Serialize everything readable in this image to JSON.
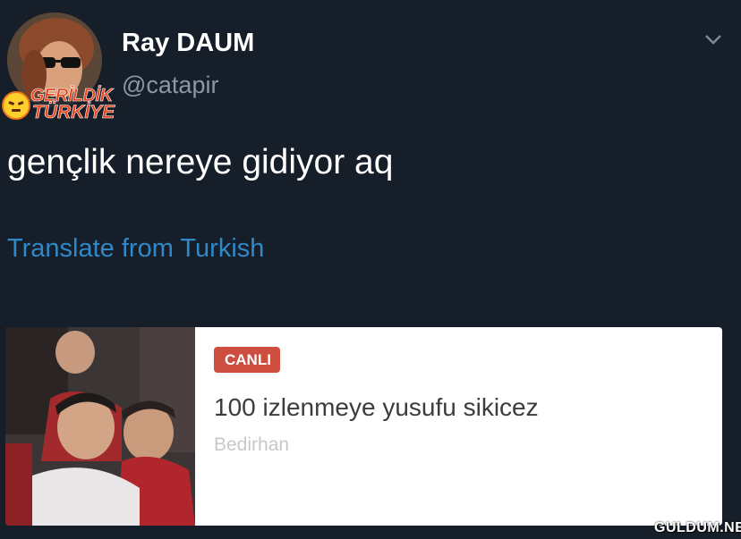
{
  "tweet": {
    "author_name": "Ray DAUM",
    "handle": "@catapir",
    "text": "gençlik nereye gidiyor aq",
    "translate_label": "Translate from Turkish"
  },
  "badge": {
    "line1": "GERİLDİK",
    "line2": "TÜRKİYE"
  },
  "card": {
    "live_badge": "CANLI",
    "title": "100 izlenmeye yusufu sikicez",
    "author": "Bedirhan"
  },
  "watermark": "GULDUM.NET",
  "icons": {
    "menu": "chevron-down-icon",
    "badge_face": "angry-face-icon"
  },
  "colors": {
    "background": "#161e29",
    "link": "#2f88c8",
    "live_badge": "#cd4d3f"
  }
}
